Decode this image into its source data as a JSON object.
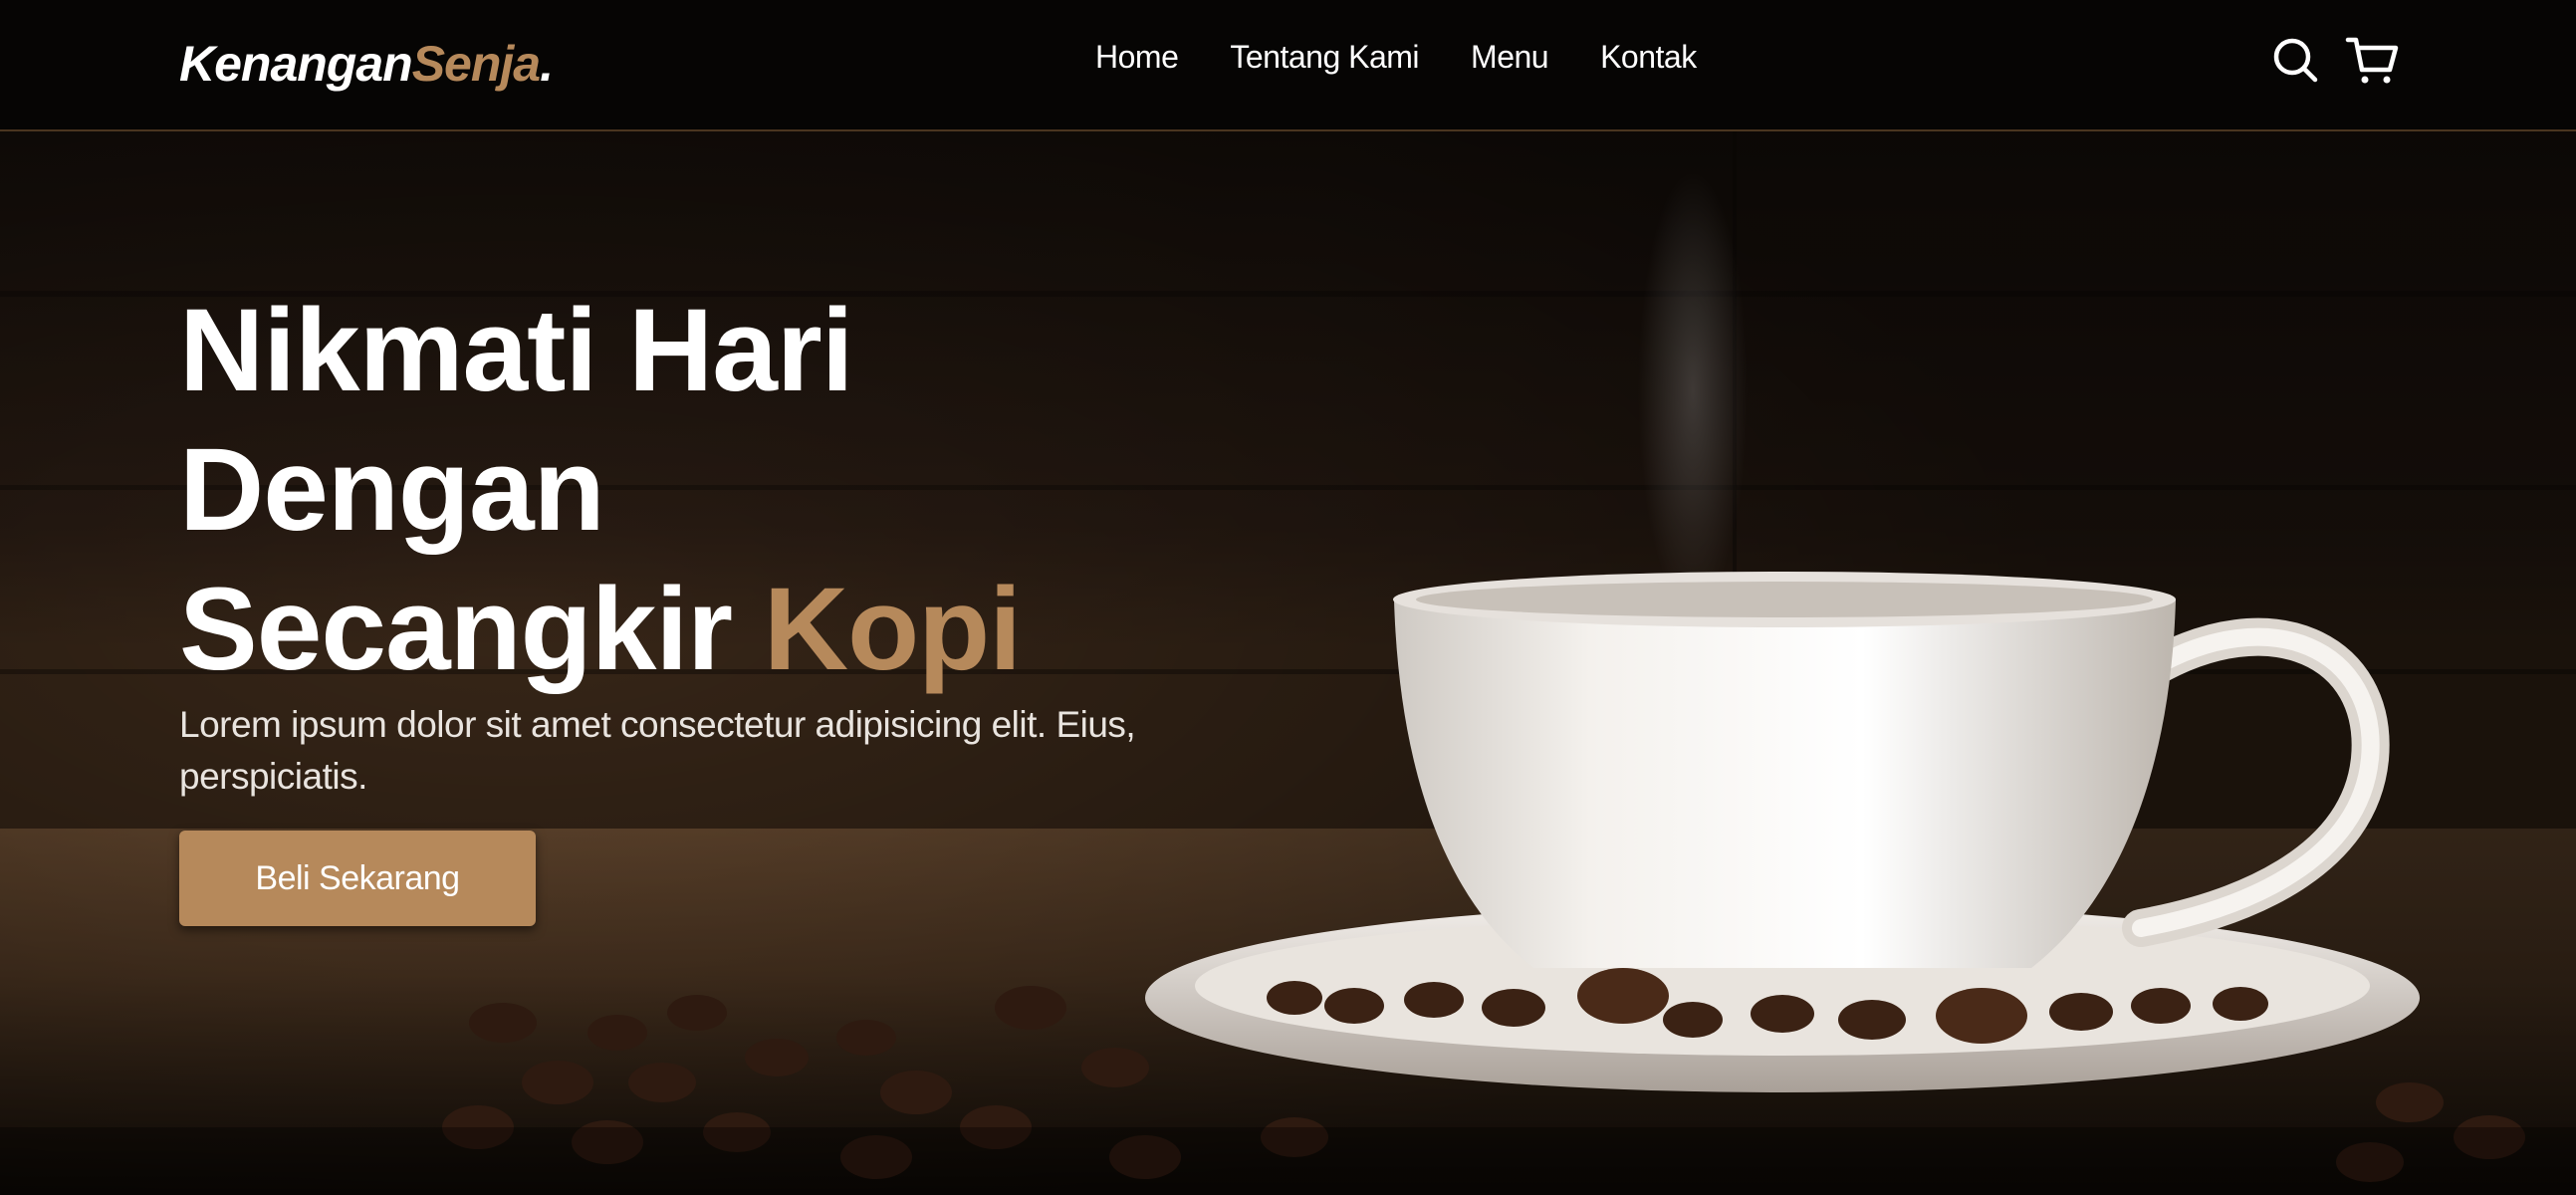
{
  "brand": {
    "name": "Kenangan",
    "accent": "Senja",
    "dot": "."
  },
  "nav": {
    "links": [
      "Home",
      "Tentang Kami",
      "Menu",
      "Kontak"
    ],
    "icons": [
      "search-icon",
      "shopping-cart-icon"
    ]
  },
  "hero": {
    "title_line1": "Nikmati Hari",
    "title_line2": "Dengan",
    "title_line3": "Secangkir",
    "title_accent": "Kopi",
    "description": "Lorem ipsum dolor sit amet consectetur adipisicing elit. Eius, perspiciatis.",
    "cta_label": "Beli Sekarang",
    "image": "coffee-cup-with-beans"
  },
  "colors": {
    "accent": "#b6895b",
    "navbar": "#060504",
    "text": "#ffffff"
  }
}
